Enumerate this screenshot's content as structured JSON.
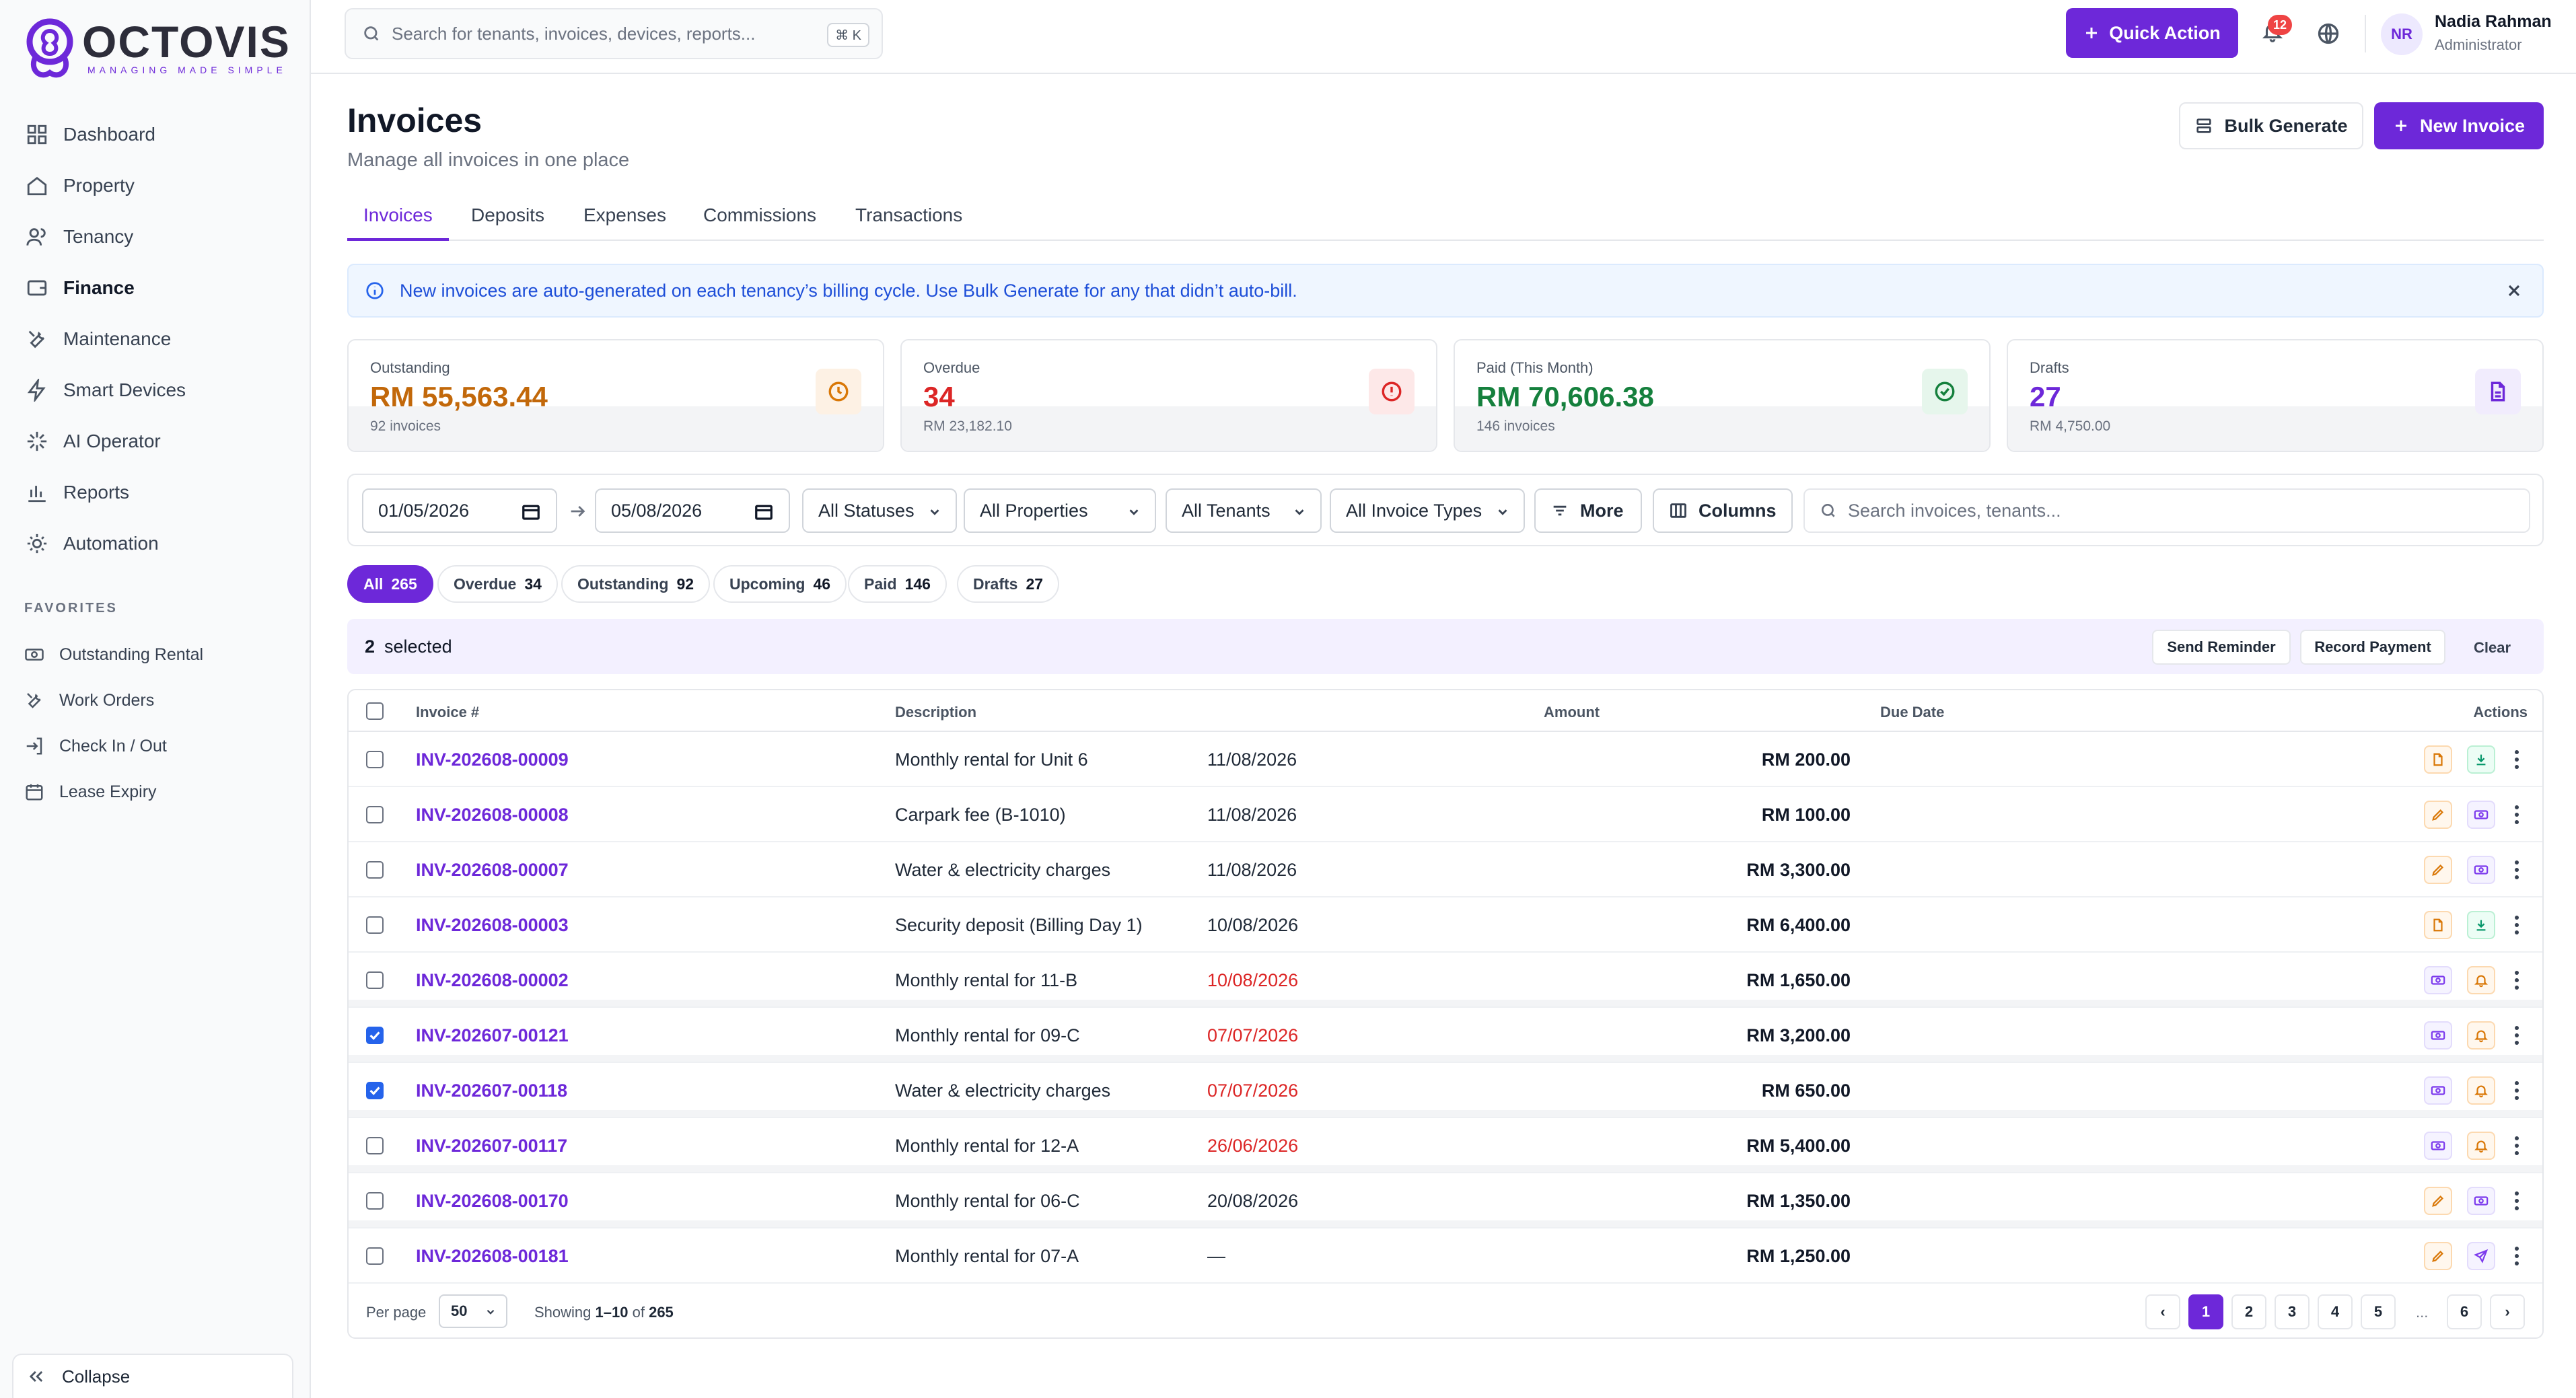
{
  "brand": {
    "name": "OCTOVIS",
    "tagline": "MANAGING MADE SIMPLE",
    "accent": "#6d28d9"
  },
  "sidebar": {
    "items": [
      {
        "label": "Dashboard",
        "icon": "grid-icon"
      },
      {
        "label": "Property",
        "icon": "home-icon"
      },
      {
        "label": "Tenancy",
        "icon": "users-icon"
      },
      {
        "label": "Finance",
        "icon": "wallet-icon",
        "active": true
      },
      {
        "label": "Maintenance",
        "icon": "wrench-icon"
      },
      {
        "label": "Smart Devices",
        "icon": "bolt-icon"
      },
      {
        "label": "AI Operator",
        "icon": "sparkle-icon"
      },
      {
        "label": "Reports",
        "icon": "bar-chart-icon"
      },
      {
        "label": "Automation",
        "icon": "sun-gear-icon"
      }
    ],
    "favorites_title": "FAVORITES",
    "favorites": [
      {
        "label": "Outstanding Rental",
        "icon": "cash-icon"
      },
      {
        "label": "Work Orders",
        "icon": "wrench-icon"
      },
      {
        "label": "Check In / Out",
        "icon": "login-icon"
      },
      {
        "label": "Lease Expiry",
        "icon": "calendar-icon"
      }
    ],
    "collapse_label": "Collapse"
  },
  "topbar": {
    "search_placeholder": "Search for tenants, invoices, devices, reports...",
    "shortcut": "⌘ K",
    "quick_action": "Quick Action",
    "notifications": "12",
    "user": {
      "initials": "NR",
      "name": "Nadia Rahman",
      "role": "Administrator"
    }
  },
  "header": {
    "title": "Invoices",
    "subtitle": "Manage all invoices in one place",
    "bulk_generate": "Bulk Generate",
    "new_invoice": "New Invoice"
  },
  "tabs": [
    "Invoices",
    "Deposits",
    "Expenses",
    "Commissions",
    "Transactions"
  ],
  "banner": {
    "text": "New invoices are auto-generated on each tenancy’s billing cycle. Use Bulk Generate for any that didn’t auto-bill."
  },
  "stats": [
    {
      "label": "Outstanding",
      "value": "RM 55,563.44",
      "sub": "92 invoices",
      "color": "#c2680a",
      "icon": "clock-icon"
    },
    {
      "label": "Overdue",
      "value": "34",
      "sub": "RM 23,182.10",
      "color": "#dc2626",
      "icon": "alert-circle-icon"
    },
    {
      "label": "Paid (This Month)",
      "value": "RM 70,606.38",
      "sub": "146 invoices",
      "color": "#15803d",
      "icon": "check-circle-icon"
    },
    {
      "label": "Drafts",
      "value": "27",
      "sub": "RM 4,750.00",
      "color": "#6d28d9",
      "icon": "file-icon"
    }
  ],
  "filters": {
    "date_from": "01/05/2026",
    "date_to": "05/08/2026",
    "status": "All Statuses",
    "properties": "All Properties",
    "tenants": "All Tenants",
    "types": "All Invoice Types",
    "more": "More",
    "columns": "Columns",
    "search_placeholder": "Search invoices, tenants..."
  },
  "pills": [
    {
      "label": "All",
      "count": "265"
    },
    {
      "label": "Overdue",
      "count": "34"
    },
    {
      "label": "Outstanding",
      "count": "92"
    },
    {
      "label": "Upcoming",
      "count": "46"
    },
    {
      "label": "Paid",
      "count": "146"
    },
    {
      "label": "Drafts",
      "count": "27"
    }
  ],
  "selection": {
    "count": "2",
    "label": "selected",
    "send_reminder": "Send Reminder",
    "record_payment": "Record Payment",
    "clear": "Clear"
  },
  "table": {
    "columns": {
      "invoice": "Invoice #",
      "description": "Description",
      "amount": "Amount",
      "due": "Due Date",
      "actions": "Actions"
    },
    "rows": [
      {
        "invoice": "INV-202608-00009",
        "description": "Monthly rental for Unit 6",
        "amount": "RM 200.00",
        "due": "11/08/2026",
        "overdue": false,
        "checked": false,
        "actions": [
          "file-icon",
          "download-icon"
        ]
      },
      {
        "invoice": "INV-202608-00008",
        "description": "Carpark fee (B-1010)",
        "amount": "RM 100.00",
        "due": "11/08/2026",
        "overdue": false,
        "checked": false,
        "actions": [
          "pencil-icon",
          "cash-icon"
        ]
      },
      {
        "invoice": "INV-202608-00007",
        "description": "Water & electricity charges",
        "amount": "RM 3,300.00",
        "due": "11/08/2026",
        "overdue": false,
        "checked": false,
        "actions": [
          "pencil-icon",
          "cash-icon"
        ]
      },
      {
        "invoice": "INV-202608-00003",
        "description": "Security deposit (Billing Day 1)",
        "amount": "RM 6,400.00",
        "due": "10/08/2026",
        "overdue": false,
        "checked": false,
        "actions": [
          "file-icon",
          "download-icon"
        ]
      },
      {
        "invoice": "INV-202608-00002",
        "description": "Monthly rental for 11-B",
        "amount": "RM 1,650.00",
        "due": "10/08/2026",
        "overdue": true,
        "checked": false,
        "actions": [
          "cash-icon",
          "bell-icon"
        ]
      },
      {
        "invoice": "INV-202607-00121",
        "description": "Monthly rental for 09-C",
        "amount": "RM 3,200.00",
        "due": "07/07/2026",
        "overdue": true,
        "checked": true,
        "actions": [
          "cash-icon",
          "bell-icon"
        ]
      },
      {
        "invoice": "INV-202607-00118",
        "description": "Water & electricity charges",
        "amount": "RM 650.00",
        "due": "07/07/2026",
        "overdue": true,
        "checked": true,
        "actions": [
          "cash-icon",
          "bell-icon"
        ]
      },
      {
        "invoice": "INV-202607-00117",
        "description": "Monthly rental for 12-A",
        "amount": "RM 5,400.00",
        "due": "26/06/2026",
        "overdue": true,
        "checked": false,
        "actions": [
          "cash-icon",
          "bell-icon"
        ]
      },
      {
        "invoice": "INV-202608-00170",
        "description": "Monthly rental for 06-C",
        "amount": "RM 1,350.00",
        "due": "20/08/2026",
        "overdue": false,
        "checked": false,
        "actions": [
          "pencil-icon",
          "cash-icon"
        ]
      },
      {
        "invoice": "INV-202608-00181",
        "description": "Monthly rental for 07-A",
        "amount": "RM 1,250.00",
        "due": "—",
        "overdue": false,
        "checked": false,
        "actions": [
          "pencil-icon",
          "send-icon"
        ]
      }
    ]
  },
  "footer": {
    "per_page_label": "Per page",
    "per_page": "50",
    "showing_prefix": "Showing",
    "showing_range": "1–10",
    "showing_of": "of",
    "showing_total": "265",
    "pages": [
      "1",
      "2",
      "3",
      "4",
      "5"
    ],
    "dots": "...",
    "last_page": "6",
    "prev": "‹",
    "next": "›"
  }
}
